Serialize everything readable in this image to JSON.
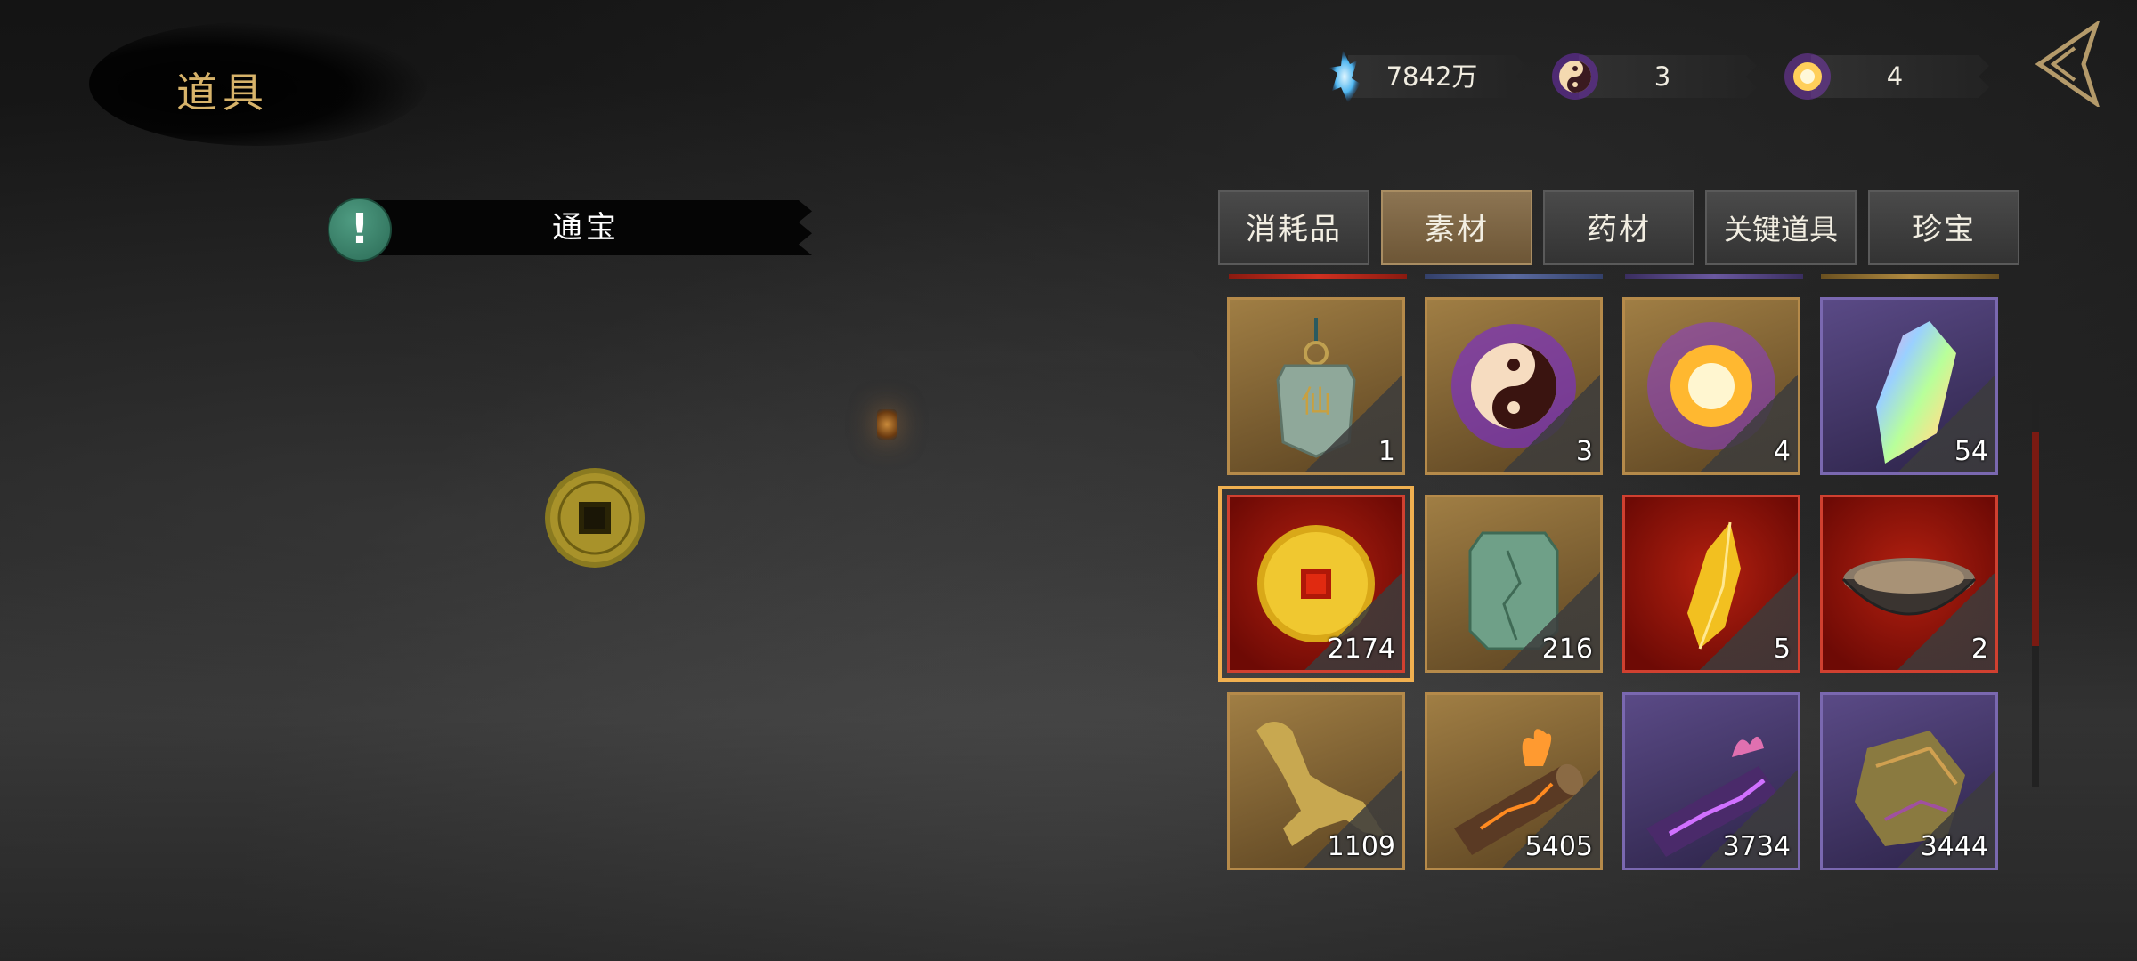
{
  "header": {
    "title": "道具"
  },
  "currencies": [
    {
      "icon": "blue-spirit-crystal-icon",
      "value": "7842万"
    },
    {
      "icon": "taiji-orb-icon",
      "value": "3"
    },
    {
      "icon": "sun-orb-icon",
      "value": "4"
    }
  ],
  "selected_item": {
    "name": "通宝",
    "icon": "exclamation-icon"
  },
  "tabs": [
    {
      "label": "消耗品",
      "active": false
    },
    {
      "label": "素材",
      "active": true
    },
    {
      "label": "药材",
      "active": false
    },
    {
      "label": "关键道具",
      "active": false
    },
    {
      "label": "珍宝",
      "active": false
    }
  ],
  "inventory": [
    {
      "icon": "jade-token-icon",
      "count": "1",
      "rarity": "gold"
    },
    {
      "icon": "taiji-orb-icon",
      "count": "3",
      "rarity": "gold"
    },
    {
      "icon": "sun-orb-icon",
      "count": "4",
      "rarity": "gold"
    },
    {
      "icon": "rainbow-crystal-icon",
      "count": "54",
      "rarity": "purple"
    },
    {
      "icon": "gold-coin-icon",
      "count": "2174",
      "rarity": "red",
      "selected": true
    },
    {
      "icon": "jade-tablet-icon",
      "count": "216",
      "rarity": "gold"
    },
    {
      "icon": "yellow-crystal-icon",
      "count": "5",
      "rarity": "red"
    },
    {
      "icon": "sand-bowl-icon",
      "count": "2",
      "rarity": "red"
    },
    {
      "icon": "golden-beast-statue-icon",
      "count": "1109",
      "rarity": "gold"
    },
    {
      "icon": "burning-log-icon",
      "count": "5405",
      "rarity": "gold"
    },
    {
      "icon": "purple-log-icon",
      "count": "3734",
      "rarity": "purple"
    },
    {
      "icon": "ore-stone-icon",
      "count": "3444",
      "rarity": "purple"
    }
  ],
  "colors": {
    "accent_gold": "#d7b36a",
    "rarity_red": "#d04030",
    "rarity_purple": "#7a68b0",
    "rarity_gold": "#b58a4a"
  }
}
